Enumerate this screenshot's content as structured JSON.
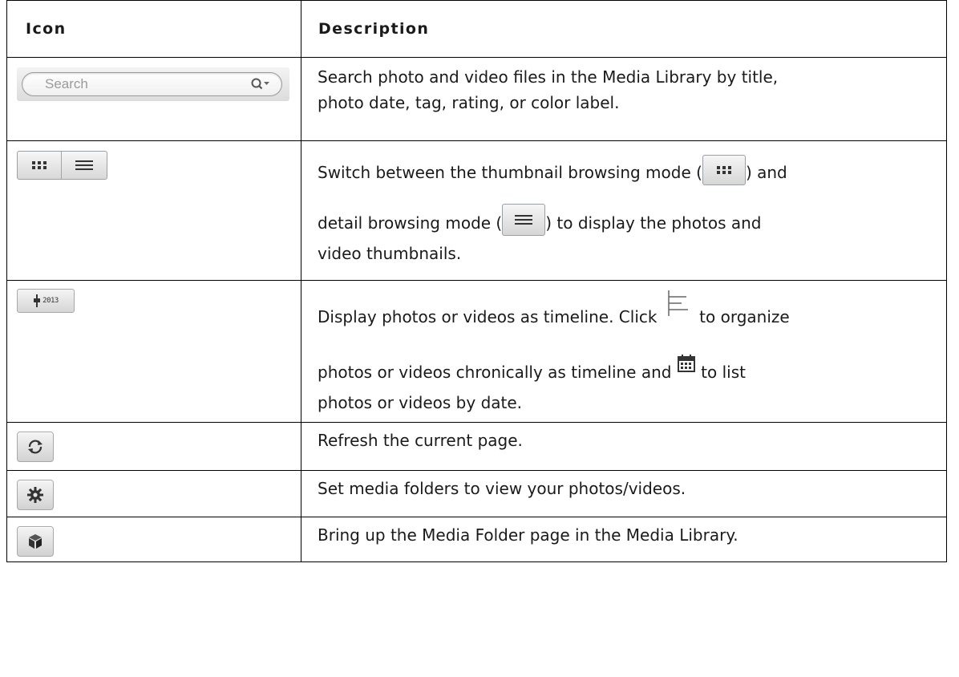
{
  "table": {
    "headers": {
      "icon": "Icon",
      "description": "Description"
    },
    "rows": [
      {
        "icon": "search-field",
        "search_placeholder": "Search",
        "lines": [
          "Search photo and video files in the Media Library by title,",
          "photo date, tag, rating, or color label."
        ]
      },
      {
        "icon": "browse-mode-toggle",
        "text_a": "Switch between the thumbnail browsing mode (",
        "text_b": ") and",
        "text_c": "detail browsing mode (",
        "text_d": ") to display the photos and",
        "text_e": "video thumbnails."
      },
      {
        "icon": "timeline-button",
        "year_label": "2013",
        "text_a": "Display photos or videos as timeline. Click ",
        "text_b": " to organize",
        "text_c": "photos or videos chronically as timeline and ",
        "text_d": " to list",
        "text_e": "photos or videos by date."
      },
      {
        "icon": "refresh-button",
        "lines": [
          "Refresh the current page."
        ]
      },
      {
        "icon": "settings-button",
        "lines": [
          "Set media folders to view your photos/videos."
        ]
      },
      {
        "icon": "media-folder-button",
        "lines": [
          "Bring up the Media Folder page in the Media Library."
        ]
      }
    ]
  }
}
